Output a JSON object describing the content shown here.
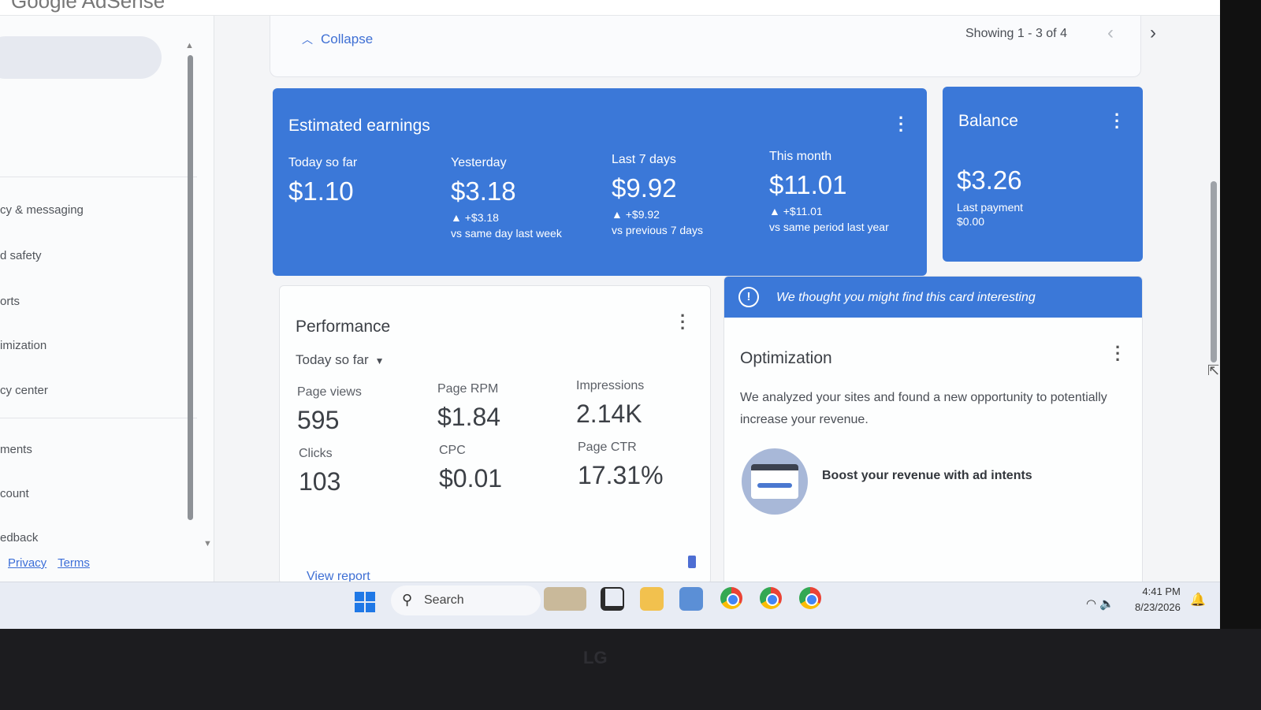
{
  "topbar": {
    "logo": "Google AdSense"
  },
  "sidebar": {
    "items": [
      {
        "label": "cy & messaging"
      },
      {
        "label": "d safety"
      },
      {
        "label": "orts"
      },
      {
        "label": "imization"
      },
      {
        "label": "cy center"
      },
      {
        "label": "ments"
      },
      {
        "label": "count"
      },
      {
        "label": "edback"
      }
    ],
    "footer": {
      "privacy": "Privacy",
      "terms": "Terms"
    }
  },
  "pager": {
    "collapse_label": "Collapse",
    "showing": "Showing 1 - 3 of 4"
  },
  "earnings": {
    "title": "Estimated earnings",
    "today": {
      "label": "Today so far",
      "value": "$1.10"
    },
    "yesterday": {
      "label": "Yesterday",
      "value": "$3.18",
      "delta": "▲ +$3.18",
      "sub": "vs same day last week"
    },
    "last7": {
      "label": "Last 7 days",
      "value": "$9.92",
      "delta": "▲ +$9.92",
      "sub": "vs previous 7 days"
    },
    "month": {
      "label": "This month",
      "value": "$11.01",
      "delta": "▲ +$11.01",
      "sub": "vs same period last year"
    }
  },
  "balance": {
    "title": "Balance",
    "value": "$3.26",
    "last_payment_label": "Last payment",
    "last_payment_value": "$0.00"
  },
  "performance": {
    "title": "Performance",
    "range": "Today so far",
    "metrics": {
      "page_views": {
        "label": "Page views",
        "value": "595"
      },
      "page_rpm": {
        "label": "Page RPM",
        "value": "$1.84"
      },
      "impressions": {
        "label": "Impressions",
        "value": "2.14K"
      },
      "clicks": {
        "label": "Clicks",
        "value": "103"
      },
      "cpc": {
        "label": "CPC",
        "value": "$0.01"
      },
      "page_ctr": {
        "label": "Page CTR",
        "value": "17.31%"
      }
    },
    "view_report": "View report"
  },
  "optimization": {
    "banner": "We thought you might find this card interesting",
    "title": "Optimization",
    "description": "We analyzed your sites and found a new opportunity to potentially increase your revenue.",
    "boost": "Boost your revenue with ad intents"
  },
  "taskbar": {
    "search_label": "Search",
    "time": "4:41 PM",
    "date": "8/23/2026"
  },
  "monitor": {
    "brand": "LG"
  },
  "colors": {
    "card_blue": "#3b78d8",
    "link_blue": "#3e6fd4"
  }
}
